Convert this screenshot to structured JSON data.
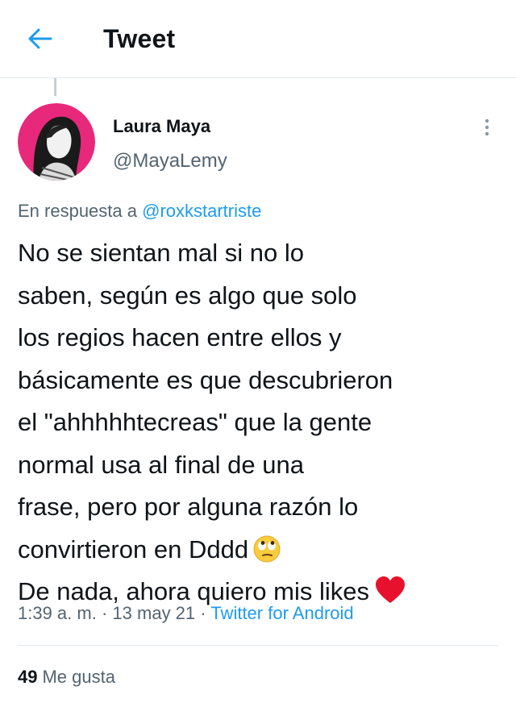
{
  "header": {
    "title": "Tweet",
    "back_icon": "arrow-left-icon",
    "accent": "#1d9bf0"
  },
  "author": {
    "name": "Laura Maya",
    "handle": "@MayaLemy",
    "avatar_icon": "user-avatar"
  },
  "reply": {
    "prefix": "En respuesta a",
    "to": "@roxkstartriste"
  },
  "tweet": {
    "lines": [
      "No se sientan mal si no lo",
      "saben, según es algo que solo",
      "los regios hacen entre ellos y",
      "básicamente es que descubrieron",
      "el \"ahhhhhtecreas\" que la gente",
      "normal usa al final de una",
      "frase, pero por alguna razón lo",
      "convirtieron en Dddd",
      "De nada, ahora quiero mis likes"
    ],
    "emoji_line_8": "face-with-rolling-eyes",
    "emoji_line_9": "red-heart"
  },
  "meta": {
    "time": "1:39 a. m.",
    "date": "13 may 21",
    "source": "Twitter for Android",
    "separator": "·"
  },
  "stats": {
    "likes_count": "49",
    "likes_label": "Me gusta"
  },
  "colors": {
    "text": "#0f1419",
    "secondary": "#536471",
    "link": "#1d9bf0",
    "divider": "#e1e8ed",
    "avatar_bg": "#e8287a"
  }
}
